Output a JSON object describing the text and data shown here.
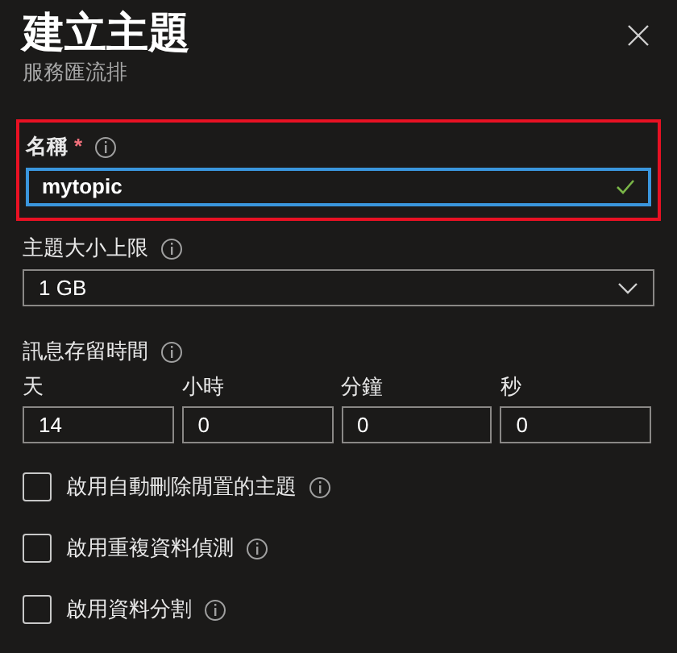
{
  "panel": {
    "title": "建立主題",
    "subtitle": "服務匯流排"
  },
  "name_field": {
    "label": "名稱",
    "required_mark": "*",
    "value": "mytopic",
    "valid": true,
    "focused": true,
    "highlighted": true
  },
  "size_field": {
    "label": "主題大小上限",
    "value": "1 GB"
  },
  "retention": {
    "label": "訊息存留時間",
    "fields": [
      {
        "label": "天",
        "value": "14"
      },
      {
        "label": "小時",
        "value": "0"
      },
      {
        "label": "分鐘",
        "value": "0"
      },
      {
        "label": "秒",
        "value": "0"
      }
    ]
  },
  "options": [
    {
      "label": "啟用自動刪除閒置的主題",
      "checked": false
    },
    {
      "label": "啟用重複資料偵測",
      "checked": false
    },
    {
      "label": "啟用資料分割",
      "checked": false
    }
  ]
}
